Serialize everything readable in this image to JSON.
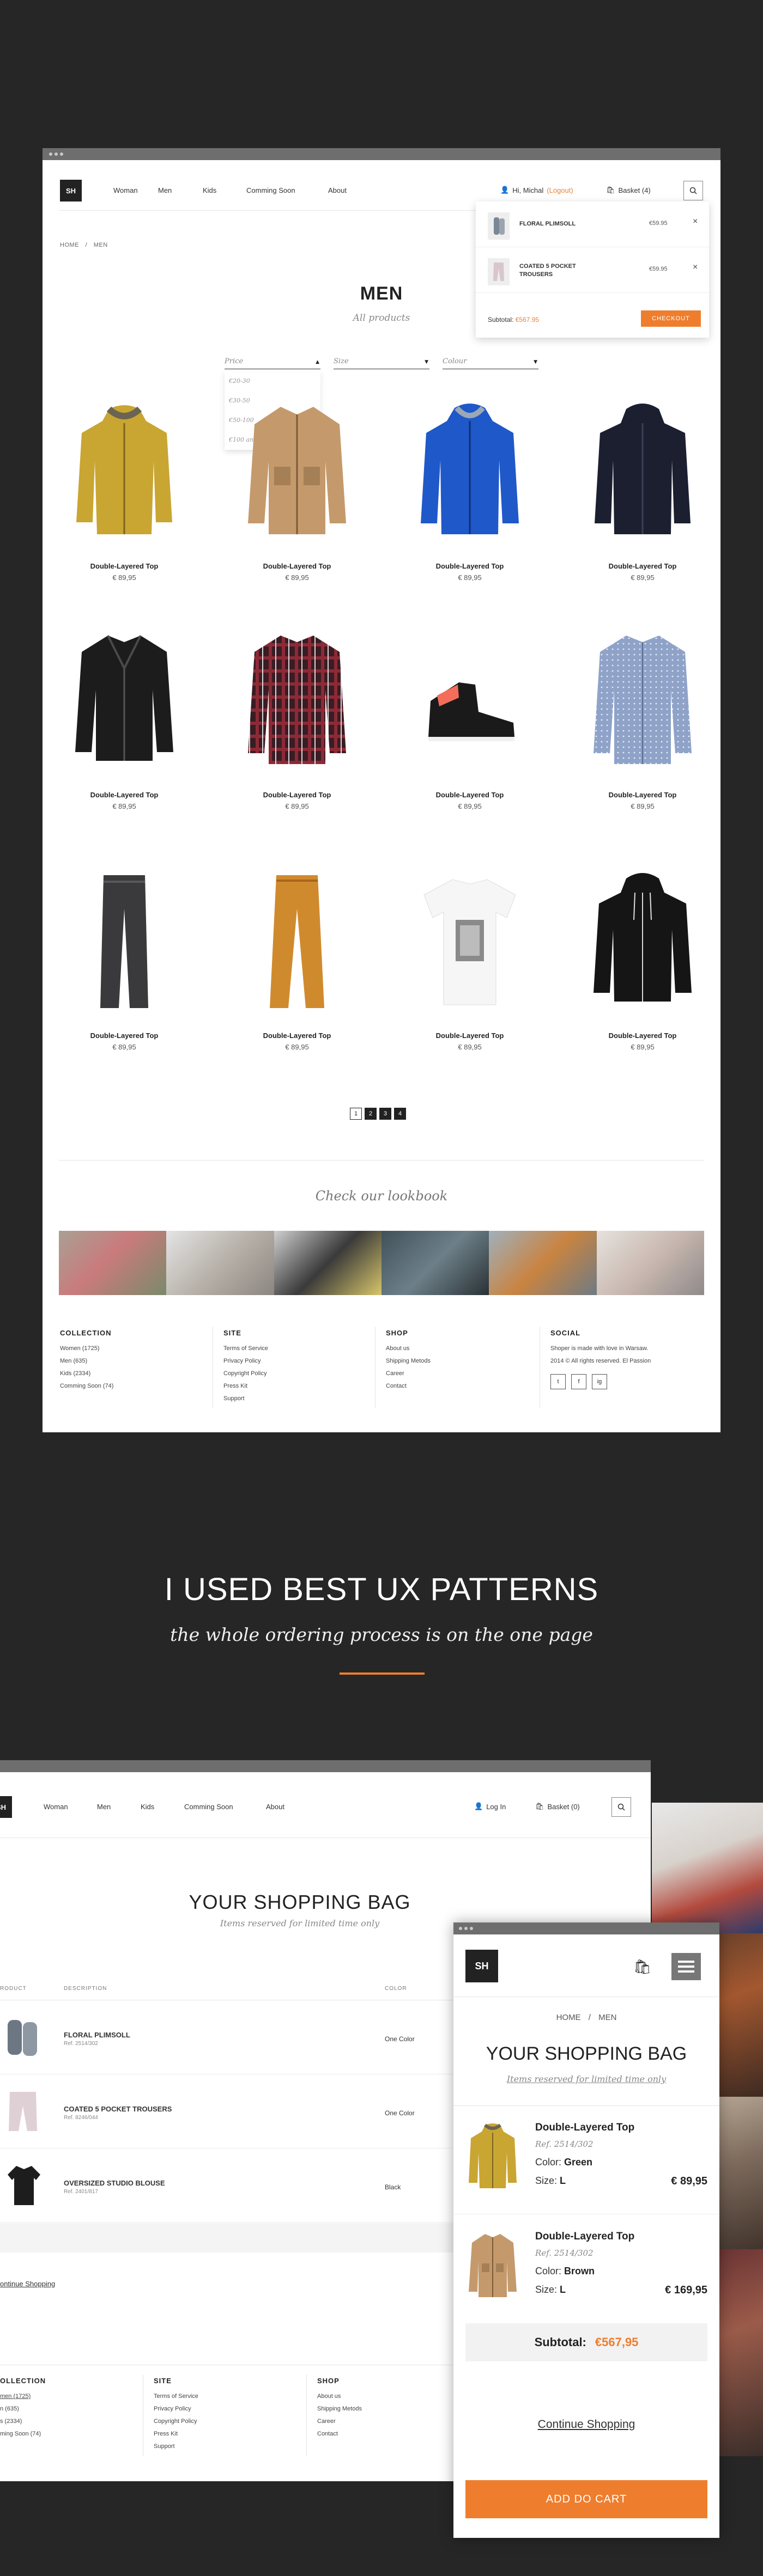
{
  "brand": {
    "logo": "SH",
    "accent": "#ee7e2e"
  },
  "nav": {
    "items": [
      "Woman",
      "Men",
      "Kids",
      "Comming Soon",
      "About"
    ],
    "greeting": "Hi, Michal",
    "logout": "(Logout)",
    "basket": "Basket (4)",
    "login": "Log In",
    "basket_empty": "Basket (0)"
  },
  "breadcrumb": {
    "home": "HOME",
    "sep": "/",
    "current": "MEN"
  },
  "page": {
    "title": "MEN",
    "subtitle": "All products"
  },
  "filters": {
    "price": "Price",
    "size": "Size",
    "colour": "Colour",
    "price_options": [
      "€20-30",
      "€30-50",
      "€50-100",
      "€100 and more"
    ]
  },
  "mini_cart": {
    "items": [
      {
        "name": "FLORAL PLIMSOLL",
        "price": "€59.95"
      },
      {
        "name": "COATED 5 POCKET TROUSERS",
        "price": "€59.95"
      }
    ],
    "subtotal_label": "Subtotal:",
    "subtotal_value": "€567.95",
    "checkout": "CHECKOUT"
  },
  "products": [
    {
      "name": "Double-Layered Top",
      "price": "€ 89,95",
      "icon": "mustard-parka"
    },
    {
      "name": "Double-Layered Top",
      "price": "€ 89,95",
      "icon": "tan-field-jacket"
    },
    {
      "name": "Double-Layered Top",
      "price": "€ 89,95",
      "icon": "blue-windbreaker"
    },
    {
      "name": "Double-Layered Top",
      "price": "€ 89,95",
      "icon": "navy-hooded-jacket"
    },
    {
      "name": "Double-Layered Top",
      "price": "€ 89,95",
      "icon": "black-leather-jacket"
    },
    {
      "name": "Double-Layered Top",
      "price": "€ 89,95",
      "icon": "plaid-shirt"
    },
    {
      "name": "Double-Layered Top",
      "price": "€ 89,95",
      "icon": "black-sneaker"
    },
    {
      "name": "Double-Layered Top",
      "price": "€ 89,95",
      "icon": "dotted-blue-shirt"
    },
    {
      "name": "Double-Layered Top",
      "price": "€ 89,95",
      "icon": "grey-jeans"
    },
    {
      "name": "Double-Layered Top",
      "price": "€ 89,95",
      "icon": "orange-chinos"
    },
    {
      "name": "Double-Layered Top",
      "price": "€ 89,95",
      "icon": "white-print-tee"
    },
    {
      "name": "Double-Layered Top",
      "price": "€ 89,95",
      "icon": "black-hoodie"
    }
  ],
  "pagination": [
    "1",
    "2",
    "3",
    "4"
  ],
  "lookbook": {
    "title": "Check our lookbook"
  },
  "footer": {
    "collection": {
      "title": "COLLECTION",
      "links": [
        "Women (1725)",
        "Men (635)",
        "Kids (2334)",
        "Comming Soon (74)"
      ]
    },
    "site": {
      "title": "SITE",
      "links": [
        "Terms of Service",
        "Privacy Policy",
        "Copyright Policy",
        "Press Kit",
        "Support"
      ]
    },
    "shop": {
      "title": "SHOP",
      "links": [
        "About us",
        "Shipping Metods",
        "Career",
        "Contact"
      ]
    },
    "social": {
      "title": "SOCIAL",
      "text1": "Shoper is made with love in Warsaw.",
      "text2": "2014 © All rights reserved. El Passion",
      "icons": [
        "t",
        "f",
        "ig"
      ]
    }
  },
  "promo": {
    "headline": "I USED BEST UX PATTERNS",
    "subline": "the whole ordering process is on the one page"
  },
  "bag": {
    "title": "YOUR SHOPPING BAG",
    "subtitle": "Items reserved for limited time only",
    "col_product": "RODUCT",
    "col_description": "DESCRIPTION",
    "col_color": "COLOR",
    "items": [
      {
        "name": "FLORAL PLIMSOLL",
        "ref": "Ref. 2514/302",
        "color": "One Color"
      },
      {
        "name": "COATED 5 POCKET TROUSERS",
        "ref": "Ref. 8246/044",
        "color": "One Color"
      },
      {
        "name": "OVERSIZED STUDIO BLOUSE",
        "ref": "Ref. 2401/817",
        "color": "Black"
      }
    ],
    "continue": "ontinue Shopping"
  },
  "footer2": {
    "collection": {
      "title": "OLLECTION",
      "links": [
        "men (1725)",
        "n (635)",
        "s (2334)",
        "ming Soon (74)"
      ]
    },
    "site": {
      "title": "SITE",
      "links": [
        "Terms of Service",
        "Privacy Policy",
        "Copyright Policy",
        "Press Kit",
        "Support"
      ]
    },
    "shop": {
      "title": "SHOP",
      "links": [
        "About us",
        "Shipping Metods",
        "Career",
        "Contact"
      ]
    }
  },
  "mobile": {
    "logo": "SH",
    "breadcrumb_home": "HOME",
    "breadcrumb_sep": "/",
    "breadcrumb_current": "MEN",
    "title": "YOUR SHOPPING BAG",
    "subtitle": "Items reserved for limited time only",
    "items": [
      {
        "name": "Double-Layered Top",
        "ref": "Ref. 2514/302",
        "color_label": "Color:",
        "color": "Green",
        "size_label": "Size:",
        "size": "L",
        "price": "€ 89,95"
      },
      {
        "name": "Double-Layered Top",
        "ref": "Ref. 2514/302",
        "color_label": "Color:",
        "color": "Brown",
        "size_label": "Size:",
        "size": "L",
        "price": "€ 169,95"
      }
    ],
    "subtotal_label": "Subtotal:",
    "subtotal_value": "€567,95",
    "continue": "Continue Shopping",
    "add_to_cart": "ADD DO CART"
  }
}
